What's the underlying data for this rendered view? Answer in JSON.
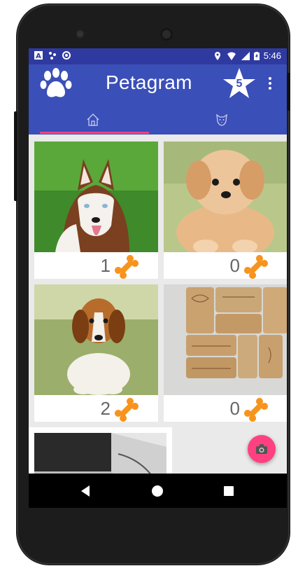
{
  "status_bar": {
    "time": "5:46",
    "left_icons": [
      "a-icon",
      "debug-icon",
      "record-icon"
    ],
    "right_icons": [
      "location-icon",
      "wifi-icon",
      "signal-icon",
      "battery-icon"
    ]
  },
  "app_bar": {
    "title": "Petagram",
    "logo_icon": "paw-icon",
    "rating_icon": "star-icon",
    "rating_count": "5",
    "menu_icon": "overflow-menu-icon"
  },
  "tabs": [
    {
      "icon": "home-icon",
      "selected": true
    },
    {
      "icon": "dog-face-icon",
      "selected": false
    }
  ],
  "pets": [
    {
      "photo": "husky",
      "likes": "1",
      "like_icon": "bone-icon"
    },
    {
      "photo": "puppy",
      "likes": "0",
      "like_icon": "bone-icon"
    },
    {
      "photo": "beagle",
      "likes": "2",
      "like_icon": "bone-icon"
    },
    {
      "photo": "corks",
      "likes": "0",
      "like_icon": "bone-icon"
    },
    {
      "photo": "desk",
      "likes": "",
      "like_icon": ""
    }
  ],
  "fab": {
    "icon": "camera-icon"
  },
  "nav_bar": {
    "icons": [
      "back-icon",
      "home-circle-icon",
      "recents-icon"
    ]
  },
  "colors": {
    "primary": "#3b4fb8",
    "primary_dark": "#2f3aa0",
    "accent": "#ff4081",
    "bone": "#f7941d"
  }
}
